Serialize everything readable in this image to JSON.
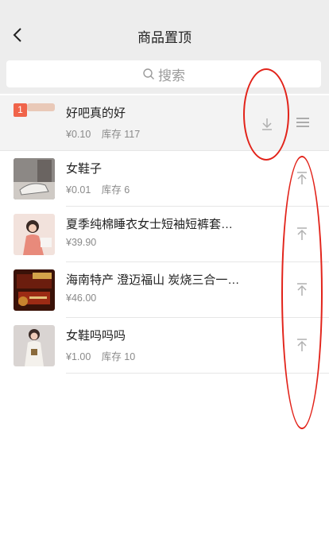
{
  "header": {
    "title": "商品置顶",
    "back_icon": "chevron-left-icon"
  },
  "search": {
    "placeholder": "搜索",
    "icon": "search-icon"
  },
  "pinned": {
    "rank": "1",
    "name": "好吧真的好",
    "price": "¥0.10",
    "stock": "库存 117",
    "action_icon": "move-down-icon",
    "drag_icon": "drag-handle-icon"
  },
  "products": [
    {
      "name": "女鞋子",
      "price": "¥0.01",
      "stock": "库存 6",
      "action_icon": "pin-to-top-icon"
    },
    {
      "name": "夏季纯棉睡衣女士短袖短裤套…",
      "price": "¥39.90",
      "stock": "",
      "action_icon": "pin-to-top-icon"
    },
    {
      "name": "海南特产 澄迈福山 炭烧三合一…",
      "price": "¥46.00",
      "stock": "",
      "action_icon": "pin-to-top-icon"
    },
    {
      "name": "女鞋吗吗吗",
      "price": "¥1.00",
      "stock": "库存 10",
      "action_icon": "pin-to-top-icon"
    }
  ],
  "colors": {
    "header_bg": "#ededed",
    "badge": "#f0644a",
    "annotation": "#e2231a",
    "icon_gray": "#b0b0b0"
  }
}
